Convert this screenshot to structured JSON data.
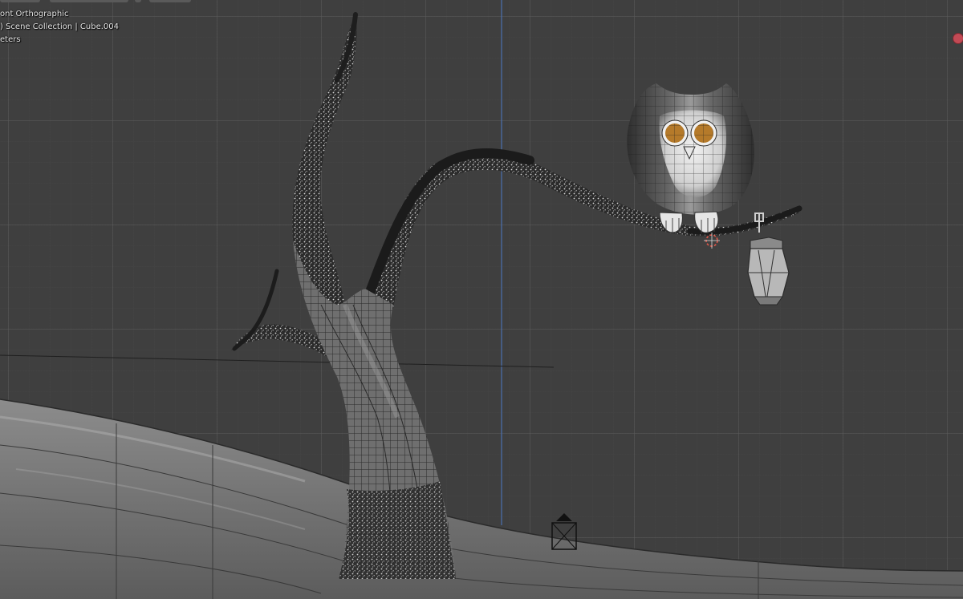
{
  "viewport": {
    "view_name": "ont Orthographic",
    "collection_info": ") Scene Collection | Cube.004",
    "units": "eters"
  },
  "colors": {
    "background": "#3f3f3f",
    "grid_major": "#5a5a5a",
    "axis_z": "#4a6fae",
    "recording_indicator": "#c24a55",
    "mesh_dark": "#2a2a2a",
    "mesh_light": "#cfcfcf",
    "owl_eye": "#b57a2a",
    "origin_marker": "#e0584a"
  },
  "icons": {
    "camera": "camera-icon",
    "cursor": "3d-cursor-icon",
    "record": "record-dot-icon"
  }
}
